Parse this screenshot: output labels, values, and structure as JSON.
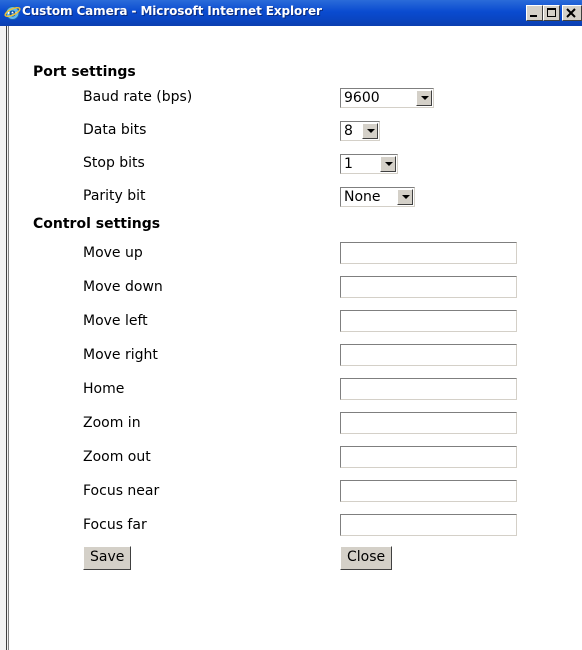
{
  "window": {
    "title": "Custom Camera - Microsoft Internet Explorer"
  },
  "port_settings": {
    "heading": "Port settings",
    "baud_rate": {
      "label": "Baud rate (bps)",
      "value": "9600"
    },
    "data_bits": {
      "label": "Data bits",
      "value": "8"
    },
    "stop_bits": {
      "label": "Stop bits",
      "value": "1"
    },
    "parity_bit": {
      "label": "Parity bit",
      "value": "None"
    }
  },
  "control_settings": {
    "heading": "Control settings",
    "fields": [
      {
        "label": "Move up",
        "value": ""
      },
      {
        "label": "Move down",
        "value": ""
      },
      {
        "label": "Move left",
        "value": ""
      },
      {
        "label": "Move right",
        "value": ""
      },
      {
        "label": "Home",
        "value": ""
      },
      {
        "label": "Zoom in",
        "value": ""
      },
      {
        "label": "Zoom out",
        "value": ""
      },
      {
        "label": "Focus near",
        "value": ""
      },
      {
        "label": "Focus far",
        "value": ""
      }
    ]
  },
  "buttons": {
    "save": "Save",
    "close": "Close"
  }
}
